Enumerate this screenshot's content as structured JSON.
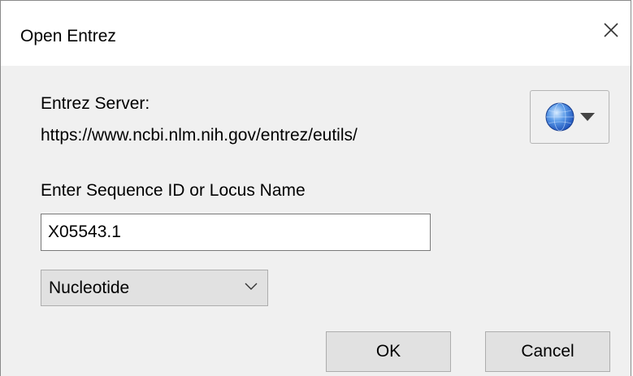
{
  "window": {
    "title": "Open Entrez",
    "close_icon": "close-icon"
  },
  "server": {
    "label": "Entrez Server:",
    "url": "https://www.ncbi.nlm.nih.gov/entrez/eutils/",
    "menu_icon": "globe-icon",
    "dropdown_icon": "caret-down-icon"
  },
  "sequence": {
    "label": "Enter Sequence ID or Locus Name",
    "value": "X05543.1"
  },
  "database": {
    "selected": "Nucleotide",
    "icon": "chevron-down-icon"
  },
  "buttons": {
    "ok": "OK",
    "cancel": "Cancel"
  },
  "colors": {
    "dialog_background": "#f0f0f0",
    "titlebar_background": "#ffffff",
    "button_background": "#e1e1e1",
    "globe_blue": "#2f6fd6"
  }
}
